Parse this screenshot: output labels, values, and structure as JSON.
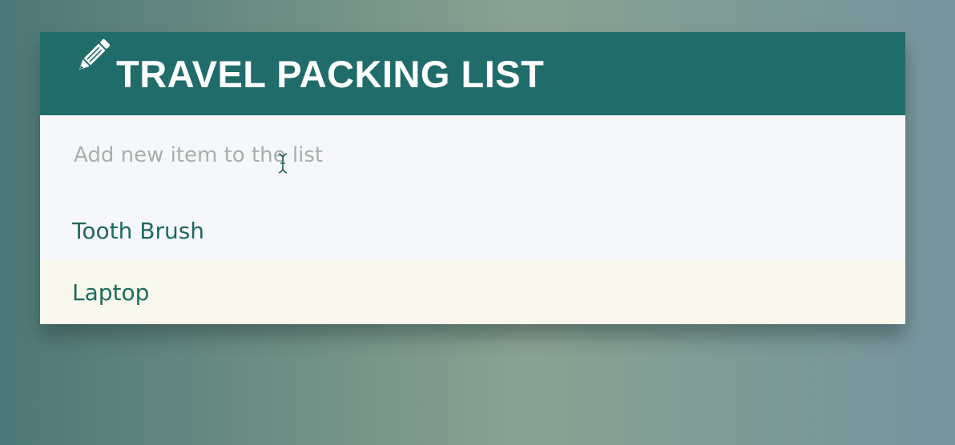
{
  "header": {
    "icon": "pencil-icon",
    "title": "TRAVEL PACKING LIST",
    "color": "#1f6c6a"
  },
  "input": {
    "placeholder": "Add new item to the list",
    "value": ""
  },
  "items": [
    {
      "label": "Tooth Brush"
    },
    {
      "label": "Laptop"
    }
  ]
}
